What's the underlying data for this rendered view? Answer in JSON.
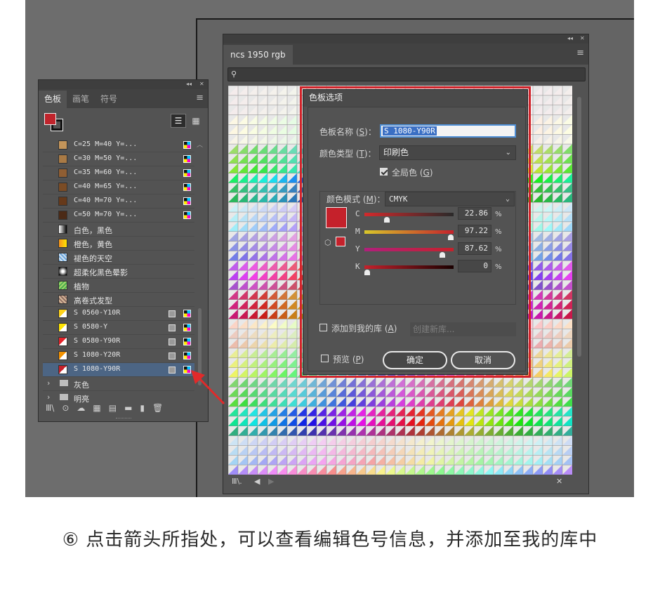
{
  "left_panel": {
    "tabs": [
      "色板",
      "画笔",
      "符号"
    ],
    "active_tab": "色板",
    "rows": [
      {
        "label": "C=25 M=40 Y=...",
        "color": "#c4955a",
        "kind": "process"
      },
      {
        "label": "C=30 M=50 Y=...",
        "color": "#a97a45",
        "kind": "process"
      },
      {
        "label": "C=35 M=60 Y=...",
        "color": "#8f5e33",
        "kind": "process"
      },
      {
        "label": "C=40 M=65 Y=...",
        "color": "#7b4c25",
        "kind": "process"
      },
      {
        "label": "C=40 M=70 Y=...",
        "color": "#66391a",
        "kind": "process"
      },
      {
        "label": "C=50 M=70 Y=...",
        "color": "#4b2a16",
        "kind": "process"
      },
      {
        "label": "白色，黑色",
        "color": "linear-gradient(90deg,#ffffff,#000000)",
        "kind": "gradient"
      },
      {
        "label": "橙色，黄色",
        "color": "linear-gradient(90deg,#f7931e,#ffe600)",
        "kind": "gradient"
      },
      {
        "label": "褪色的天空",
        "color": "repeating-linear-gradient(45deg,#6fa8dc 0 2px,#cfe2f3 2px 4px)",
        "kind": "pattern"
      },
      {
        "label": "超柔化黑色晕影",
        "color": "radial-gradient(#ffffff 20%,#000000 90%)",
        "kind": "gradient"
      },
      {
        "label": "植物",
        "color": "repeating-linear-gradient(135deg,#4caf50 0 2px,#a5d66a 2px 4px)",
        "kind": "pattern"
      },
      {
        "label": "高卷式发型",
        "color": "repeating-linear-gradient(45deg,#8d6e63 0 2px,#d7b899 2px 4px)",
        "kind": "pattern"
      },
      {
        "label": "S 0560-Y10R",
        "color": "linear-gradient(135deg,#ffd31a 50%,#ffffff 50%)",
        "kind": "global"
      },
      {
        "label": "S 0580-Y",
        "color": "linear-gradient(135deg,#ffe400 50%,#ffffff 50%)",
        "kind": "global"
      },
      {
        "label": "S 0580-Y90R",
        "color": "linear-gradient(135deg,#e5242b 50%,#ffffff 50%)",
        "kind": "global"
      },
      {
        "label": "S 1080-Y20R",
        "color": "linear-gradient(135deg,#f39200 50%,#ffffff 50%)",
        "kind": "global"
      },
      {
        "label": "S 1080-Y90R",
        "color": "linear-gradient(135deg,#c5212b 50%,#ffffff 50%)",
        "kind": "global",
        "selected": true
      },
      {
        "label": "灰色",
        "kind": "folder"
      },
      {
        "label": "明亮",
        "kind": "folder"
      }
    ]
  },
  "library_panel": {
    "tab": "ncs 1950 rgb"
  },
  "dialog": {
    "title": "色板选项",
    "name_label": "色板名称",
    "name_key": "S",
    "name_value": "S 1080-Y90R",
    "type_label": "颜色类型",
    "type_key": "T",
    "type_value": "印刷色",
    "global_label": "全局色",
    "global_key": "G",
    "global_checked": true,
    "mode_label": "颜色模式",
    "mode_key": "M",
    "mode_value": "CMYK",
    "swatch_color": "#c5212b",
    "channels": [
      {
        "name": "C",
        "value": "22.86",
        "level": 0.2286,
        "track": "linear-gradient(90deg,#d22a2c,#2a2a2a)"
      },
      {
        "name": "M",
        "value": "97.22",
        "level": 0.9722,
        "track": "linear-gradient(90deg,#d9c72a,#c5212b)"
      },
      {
        "name": "Y",
        "value": "87.62",
        "level": 0.8762,
        "track": "linear-gradient(90deg,#b0207c,#c5212b)"
      },
      {
        "name": "K",
        "value": "0",
        "level": 0,
        "track": "linear-gradient(90deg,#c5212b,#1a0000)"
      }
    ],
    "percent": "%",
    "add_library_label": "添加到我的库",
    "add_library_key": "A",
    "create_library": "创建新库...",
    "preview_label": "预览",
    "preview_key": "P",
    "ok": "确定",
    "cancel": "取消"
  },
  "caption": "⑥ 点击箭头所指处，可以查看编辑色号信息，并添加至我的库中",
  "accent": "#d2232a"
}
